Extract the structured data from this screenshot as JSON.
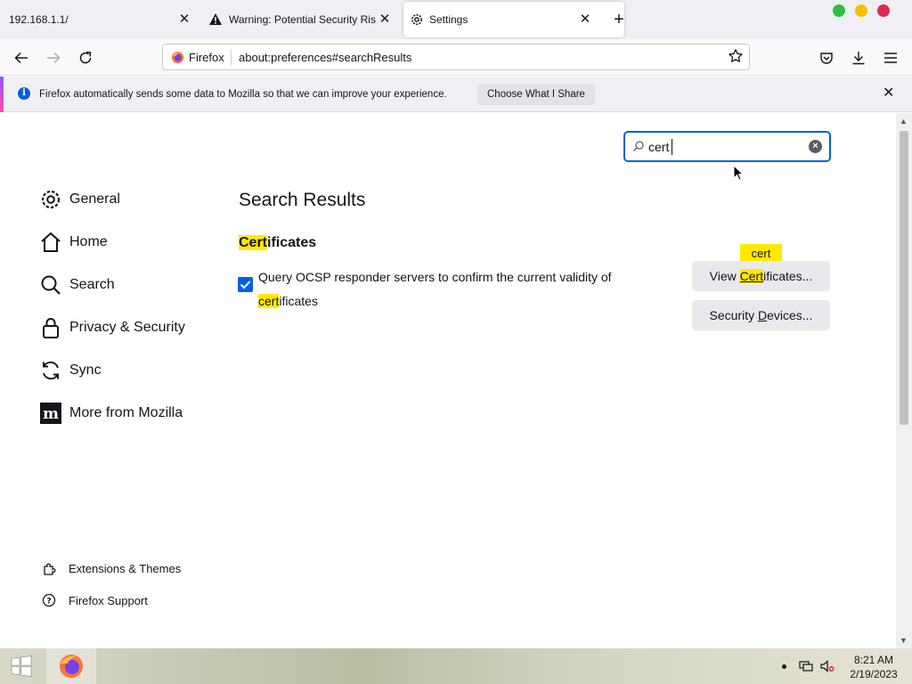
{
  "browser": {
    "tabs": [
      {
        "title": "192.168.1.1/",
        "active": false
      },
      {
        "title": "Warning: Potential Security Risk Ahead",
        "active": false
      },
      {
        "title": "Settings",
        "active": true
      }
    ],
    "identity_label": "Firefox",
    "url": "about:preferences#searchResults"
  },
  "notification": {
    "message": "Firefox automatically sends some data to Mozilla so that we can improve your experience.",
    "button": "Choose What I Share"
  },
  "search": {
    "value": "cert"
  },
  "sidebar": {
    "items": [
      {
        "label": "General",
        "icon": "gear-icon"
      },
      {
        "label": "Home",
        "icon": "home-icon"
      },
      {
        "label": "Search",
        "icon": "search-icon"
      },
      {
        "label": "Privacy & Security",
        "icon": "lock-icon"
      },
      {
        "label": "Sync",
        "icon": "sync-icon"
      },
      {
        "label": "More from Mozilla",
        "icon": "mozilla-icon"
      }
    ],
    "footer": [
      {
        "label": "Extensions & Themes",
        "icon": "puzzle-icon"
      },
      {
        "label": "Firefox Support",
        "icon": "help-icon"
      }
    ]
  },
  "main": {
    "heading": "Search Results",
    "section": {
      "highlight": "Cert",
      "rest": "ificates"
    },
    "ocsp": {
      "checked": true,
      "text_before": "Query OCSP responder servers to confirm the current validity of ",
      "highlight": "cert",
      "text_after": "ificates"
    },
    "view_certificates": {
      "before": "View ",
      "highlight": "Cert",
      "after": "ificates..."
    },
    "security_devices": {
      "before": "Security ",
      "accesskey": "D",
      "after": "evices..."
    },
    "tooltip": "cert"
  },
  "taskbar": {
    "time": "8:21 AM",
    "date": "2/19/2023"
  },
  "colors": {
    "accent": "#0061e0",
    "highlight": "#ffe900",
    "window_close": "#e22850",
    "window_min": "#f5bf00",
    "window_max": "#2ac140"
  }
}
